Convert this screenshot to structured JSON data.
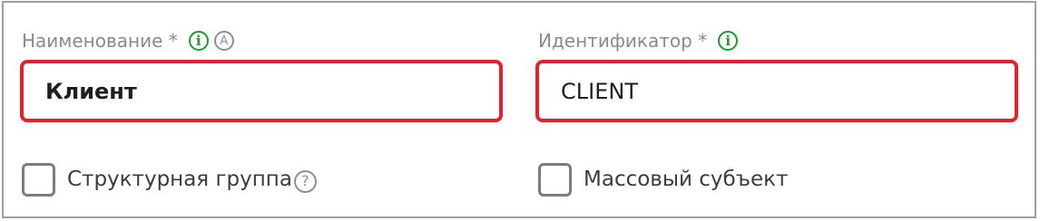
{
  "form": {
    "name_field": {
      "label": "Наименование *",
      "value": "Клиент",
      "info_icon": "info-icon",
      "auto_icon": "A"
    },
    "id_field": {
      "label": "Идентификатор *",
      "value": "CLIENT",
      "info_icon": "info-icon"
    },
    "structural_group": {
      "label": "Структурная группа",
      "checked": false,
      "help_icon": "?"
    },
    "mass_subject": {
      "label": "Массовый субъект",
      "checked": false
    }
  },
  "colors": {
    "error_border": "#e3202f",
    "info_green": "#1f9a2e",
    "label_gray": "#8a8a8a"
  }
}
